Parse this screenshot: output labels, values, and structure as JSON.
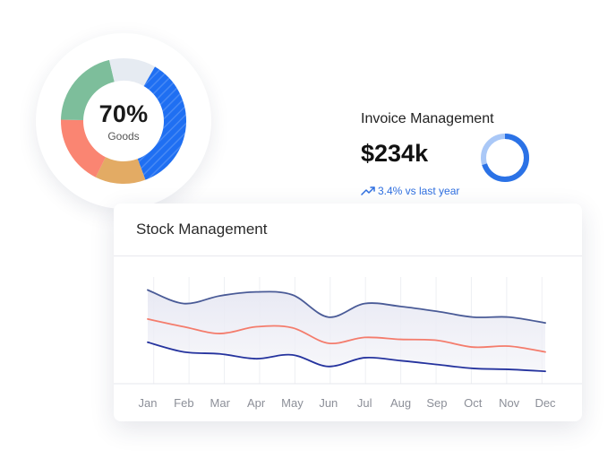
{
  "goods_widget": {
    "percent_label": "70%",
    "caption": "Goods",
    "segments": [
      {
        "name": "blue",
        "value": 36,
        "color": "#1f6ff2"
      },
      {
        "name": "gold",
        "value": 13,
        "color": "#e3ab64"
      },
      {
        "name": "salmon",
        "value": 18,
        "color": "#fa8572"
      },
      {
        "name": "green",
        "value": 21,
        "color": "#7dbe9b"
      },
      {
        "name": "light",
        "value": 12,
        "color": "#e6ebf2"
      }
    ]
  },
  "invoice": {
    "title": "Invoice Management",
    "amount": "$234k",
    "trend": "3.4% vs last year",
    "ring_progress": 0.7,
    "colors": {
      "ring": "#2b72e6",
      "ring_track": "#aac8f7",
      "trend": "#2f6fe0"
    }
  },
  "stock": {
    "title": "Stock Management"
  },
  "chart_data": {
    "type": "line",
    "title": "",
    "xlabel": "",
    "ylabel": "",
    "categories": [
      "Jan",
      "Feb",
      "Mar",
      "Apr",
      "May",
      "Jun",
      "Jul",
      "Aug",
      "Sep",
      "Oct",
      "Nov",
      "Dec"
    ],
    "ylim": [
      0,
      100
    ],
    "grid": "vertical",
    "series": [
      {
        "values": [
          94,
          80,
          88,
          92,
          89,
          66,
          80,
          77,
          72,
          66,
          66,
          60
        ],
        "color": "#4a5b97"
      },
      {
        "values": [
          64,
          56,
          49,
          56,
          55,
          39,
          45,
          43,
          42,
          35,
          36,
          30
        ],
        "color": "#f47c6c"
      },
      {
        "values": [
          40,
          30,
          28,
          23,
          27,
          15,
          24,
          21,
          17,
          13,
          12,
          10
        ],
        "color": "#25339e"
      }
    ]
  }
}
